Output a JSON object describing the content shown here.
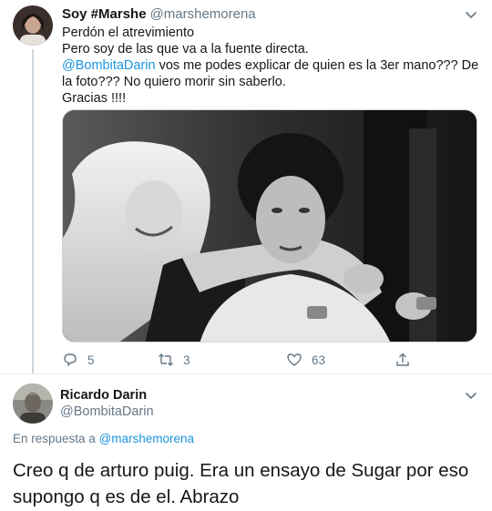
{
  "tweet": {
    "author_name": "Soy #Marshe",
    "author_handle": "@marshemorena",
    "line1": "Perdón el atrevimiento",
    "line2": "Pero soy de las que va a la fuente directa.",
    "mention": "@BombitaDarin",
    "line3_rest": " vos me podes explicar de quien es la 3er mano??? De la foto??? No quiero morir sin saberlo.",
    "line4": "Gracias !!!!",
    "photo_icon": "black-and-white-photo",
    "actions": {
      "reply_count": "5",
      "retweet_count": "3",
      "like_count": "63"
    }
  },
  "reply": {
    "author_name": "Ricardo Darin",
    "author_handle": "@BombitaDarin",
    "reply_prefix": "En respuesta a ",
    "reply_mention": "@marshemorena",
    "text": "Creo q de arturo puig. Era un ensayo de Sugar por eso supongo q es de el. Abrazo"
  },
  "colors": {
    "link": "#1b95e0",
    "muted": "#657786",
    "text": "#14171a",
    "border": "#e6ecf0"
  }
}
